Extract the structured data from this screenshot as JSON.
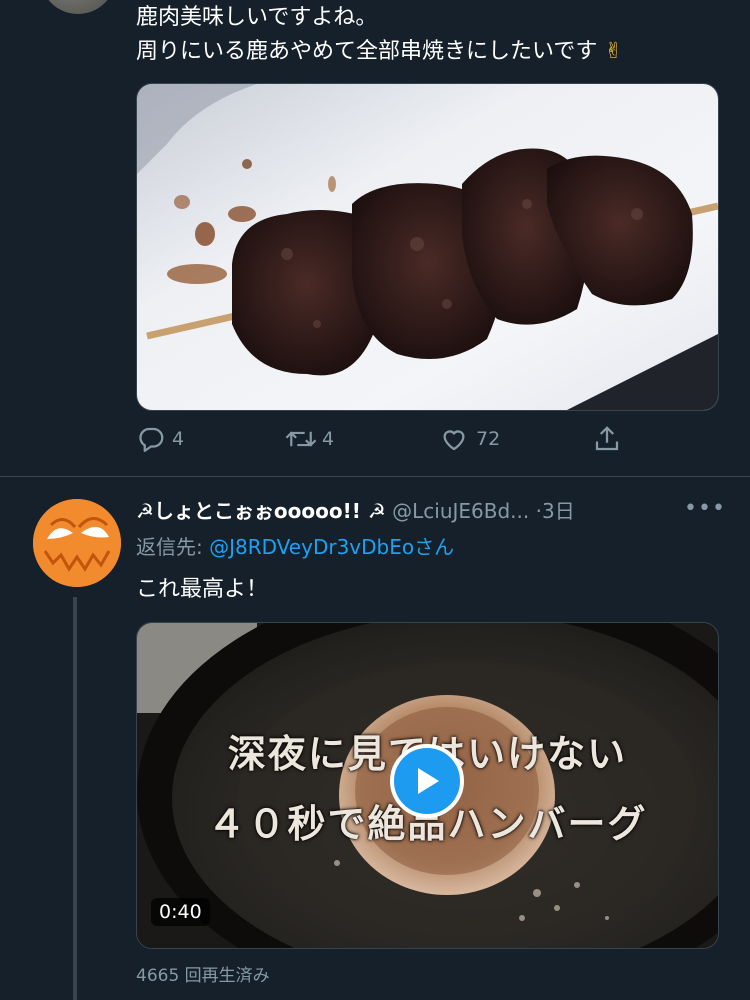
{
  "tweet1": {
    "text_line1": "鹿肉美味しいですよね。",
    "text_line2": "周りにいる鹿あやめて全部串焼きにしたいです",
    "emoji": "✌",
    "media_alt": "grilled venison skewer on white plate",
    "replies": "4",
    "retweets": "4",
    "likes": "72"
  },
  "tweet2": {
    "display_name": "☭しょとこぉぉooooo!! ☭",
    "handle": "@LciuJE6Bd...",
    "separator": "·",
    "time": "3日",
    "more": "•••",
    "reply_prefix": "返信先: ",
    "reply_to": "@J8RDVeyDr3vDbEoさん",
    "text": "これ最高よ！",
    "video": {
      "caption_line1": "深夜に見てはいけない",
      "caption_line2": "４０秒で絶品ハンバーグ",
      "duration": "0:40"
    },
    "views": "4665 回再生済み"
  },
  "colors": {
    "background": "#15202b",
    "secondary_text": "#8899a6",
    "link": "#1da1f2",
    "divider": "#38444d",
    "avatar_orange": "#f28a2e"
  },
  "icons": [
    "reply-icon",
    "retweet-icon",
    "like-icon",
    "share-icon",
    "play-icon",
    "more-icon"
  ]
}
